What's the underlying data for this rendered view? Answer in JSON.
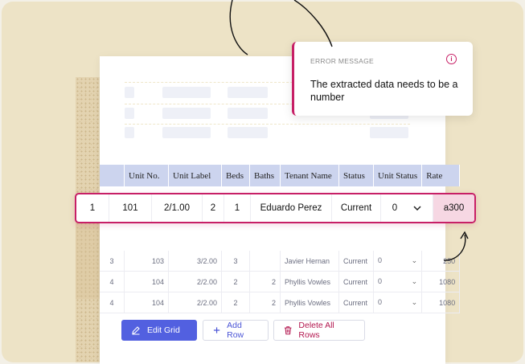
{
  "error": {
    "title": "ERROR MESSAGE",
    "message": "The extracted data needs to be a number",
    "icon": "info-icon"
  },
  "grid": {
    "columns": [
      "",
      "Unit No.",
      "Unit Label",
      "Beds",
      "Baths",
      "Tenant Name",
      "Status",
      "Unit Status",
      "Rate"
    ],
    "highlight_row": {
      "index": "1",
      "unit_no": "101",
      "unit_label": "2/1.00",
      "beds": "2",
      "baths": "1",
      "tenant": "Eduardo Perez",
      "status": "Current",
      "unit_status": "0",
      "rate": "a300"
    },
    "rows": [
      {
        "index": "3",
        "unit_no": "103",
        "unit_label": "3/2.00",
        "beds": "3",
        "baths": "",
        "tenant": "Javier Hernan",
        "status": "Current",
        "unit_status": "0",
        "rate": "250"
      },
      {
        "index": "4",
        "unit_no": "104",
        "unit_label": "2/2.00",
        "beds": "2",
        "baths": "2",
        "tenant": "Phyllis Vowles",
        "status": "Current",
        "unit_status": "0",
        "rate": "1080"
      },
      {
        "index": "4",
        "unit_no": "104",
        "unit_label": "2/2.00",
        "beds": "2",
        "baths": "2",
        "tenant": "Phyllis Vowles",
        "status": "Current",
        "unit_status": "0",
        "rate": "1080"
      }
    ]
  },
  "buttons": {
    "edit_grid": "Edit Grid",
    "add_row": "Add Row",
    "delete_all": "Delete All Rows"
  },
  "colors": {
    "accent_error": "#c71f66",
    "primary": "#5260e0",
    "header_bg": "#ccd4ee",
    "background": "#ede3c6"
  }
}
